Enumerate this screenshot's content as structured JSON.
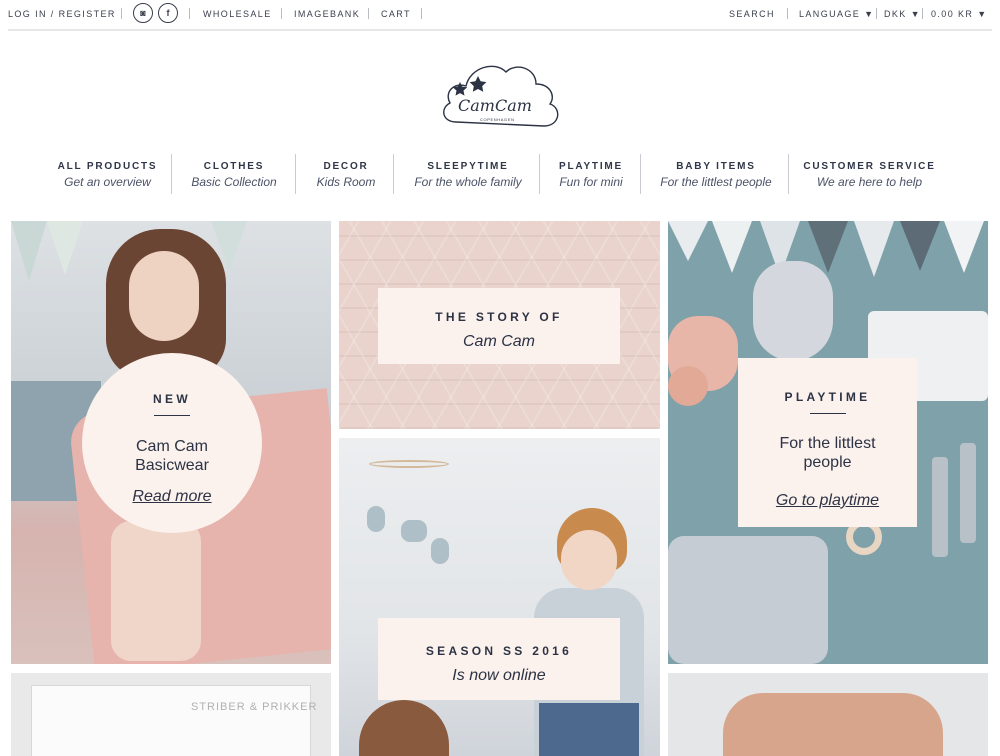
{
  "topbar": {
    "login": "LOG IN / REGISTER",
    "instagram_icon": "instagram-icon",
    "facebook_icon": "facebook-icon",
    "instagram_glyph": "◙",
    "facebook_glyph": "f",
    "wholesale": "WHOLESALE",
    "imagebank": "IMAGEBANK",
    "cart": "CART",
    "search": "SEARCH",
    "language": "LANGUAGE",
    "currency": "DKK",
    "total": "0.00 KR"
  },
  "logo": {
    "name": "CamCam",
    "subtitle": "COPENHAGEN"
  },
  "nav": [
    {
      "title": "ALL PRODUCTS",
      "subtitle": "Get an overview"
    },
    {
      "title": "CLOTHES",
      "subtitle": "Basic Collection"
    },
    {
      "title": "DECOR",
      "subtitle": "Kids Room"
    },
    {
      "title": "SLEEPYTIME",
      "subtitle": "For the whole family"
    },
    {
      "title": "PLAYTIME",
      "subtitle": "Fun for mini"
    },
    {
      "title": "BABY ITEMS",
      "subtitle": "For the littlest people"
    },
    {
      "title": "CUSTOMER SERVICE",
      "subtitle": "We are here to help"
    }
  ],
  "tiles": {
    "new": {
      "title": "NEW",
      "body_line1": "Cam Cam",
      "body_line2": "Basicwear",
      "link": "Read more"
    },
    "story": {
      "title": "THE STORY OF",
      "subtitle": "Cam Cam"
    },
    "season": {
      "title": "SEASON SS 2016",
      "subtitle": "Is now online"
    },
    "playtime": {
      "title": "PLAYTIME",
      "body_line1": "For the littlest",
      "body_line2": "people",
      "link": "Go to playtime"
    },
    "magazine_text": "STRIBER & PRIKKER"
  },
  "colors": {
    "text": "#2c3344",
    "card_bg": "#fbf1ed",
    "playtime_bg": "#7fa1a9",
    "story_bg": "#e9d3cc"
  }
}
